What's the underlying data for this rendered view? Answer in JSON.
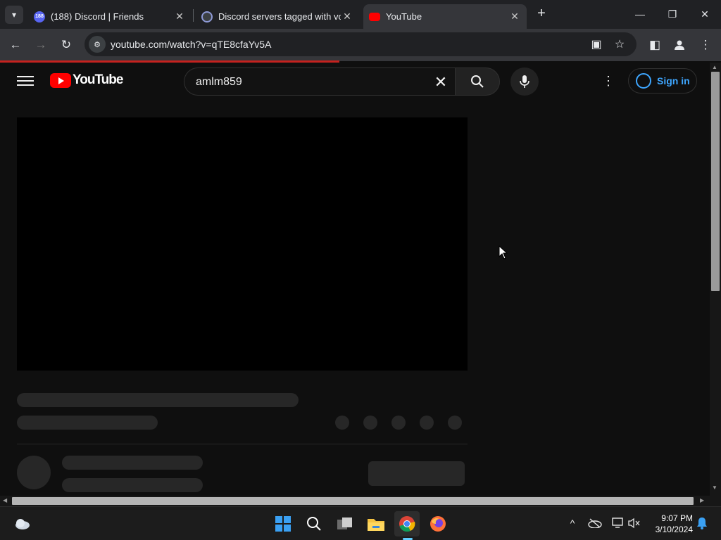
{
  "browser": {
    "tabs": [
      {
        "title": "(188) Discord | Friends",
        "badge": "188",
        "favicon": "discord-icon"
      },
      {
        "title": "Discord servers tagged with vo",
        "favicon": "disboard-icon"
      },
      {
        "title": "YouTube",
        "favicon": "youtube-icon",
        "active": true
      }
    ],
    "url": "youtube.com/watch?v=qTE8cfaYv5A",
    "colors": {
      "loading_bar": "#c5221f",
      "accent": "#3ea6ff"
    }
  },
  "youtube": {
    "logo_text": "YouTube",
    "search_query": "amlm859",
    "sign_in_label": "Sign in"
  },
  "taskbar": {
    "time": "9:07 PM",
    "date": "3/10/2024",
    "apps": [
      "windows-start",
      "search",
      "task-view",
      "file-explorer",
      "chrome",
      "firefox"
    ]
  }
}
